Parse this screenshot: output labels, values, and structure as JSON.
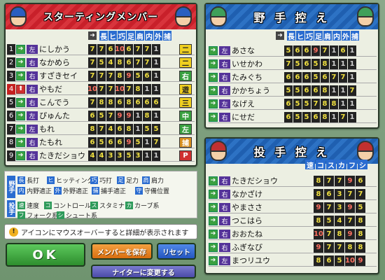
{
  "starting": {
    "title": "スターティングメンバー",
    "columns": [
      "長",
      "ヒ",
      "巧",
      "足",
      "肩",
      "内",
      "外",
      "捕"
    ],
    "players": [
      {
        "num": "1",
        "name": "にしかう",
        "hand": "左",
        "stats": [
          "7",
          "7",
          "6",
          "10",
          "6",
          "7",
          "7",
          "1"
        ],
        "pos": "二"
      },
      {
        "num": "2",
        "name": "なかめら",
        "hand": "右",
        "stats": [
          "7",
          "5",
          "4",
          "8",
          "6",
          "7",
          "7",
          "1"
        ],
        "pos": "二"
      },
      {
        "num": "3",
        "name": "すざきセイ",
        "hand": "右",
        "stats": [
          "7",
          "7",
          "7",
          "8",
          "9",
          "5",
          "6",
          "1"
        ],
        "pos": "右"
      },
      {
        "num": "4",
        "name": "やもだ",
        "hand": "右",
        "stats": [
          "10",
          "7",
          "7",
          "10",
          "7",
          "8",
          "1",
          "1"
        ],
        "pos": "遊"
      },
      {
        "num": "5",
        "name": "こんでう",
        "hand": "右",
        "stats": [
          "7",
          "8",
          "8",
          "6",
          "8",
          "6",
          "6",
          "6"
        ],
        "pos": "三"
      },
      {
        "num": "6",
        "name": "ぴゅんた",
        "hand": "左",
        "stats": [
          "6",
          "5",
          "7",
          "9",
          "9",
          "1",
          "8",
          "1"
        ],
        "pos": "中"
      },
      {
        "num": "7",
        "name": "もれ",
        "hand": "左",
        "stats": [
          "8",
          "7",
          "4",
          "6",
          "8",
          "1",
          "5",
          "5"
        ],
        "pos": "左"
      },
      {
        "num": "8",
        "name": "たもれ",
        "hand": "右",
        "stats": [
          "6",
          "5",
          "6",
          "6",
          "9",
          "5",
          "1",
          "7"
        ],
        "pos": "捕"
      },
      {
        "num": "9",
        "name": "たきだショウ",
        "hand": "右",
        "stats": [
          "4",
          "4",
          "3",
          "3",
          "5",
          "3",
          "1",
          "1"
        ],
        "pos": "P"
      }
    ]
  },
  "bench": {
    "title": "野 手 控 え",
    "columns": [
      "長",
      "ヒ",
      "巧",
      "足",
      "肩",
      "内",
      "外",
      "捕"
    ],
    "players": [
      {
        "name": "あさな",
        "hand": "左",
        "stats": [
          "5",
          "6",
          "6",
          "9",
          "7",
          "1",
          "6",
          "1"
        ]
      },
      {
        "name": "いせかわ",
        "hand": "右",
        "stats": [
          "7",
          "5",
          "6",
          "5",
          "8",
          "1",
          "1",
          "1"
        ]
      },
      {
        "name": "たみぐち",
        "hand": "右",
        "stats": [
          "6",
          "6",
          "6",
          "5",
          "6",
          "7",
          "7",
          "1"
        ]
      },
      {
        "name": "かかちょう",
        "hand": "右",
        "stats": [
          "5",
          "5",
          "6",
          "6",
          "8",
          "1",
          "1",
          "7"
        ]
      },
      {
        "name": "なげえ",
        "hand": "左",
        "stats": [
          "6",
          "5",
          "5",
          "7",
          "8",
          "8",
          "1",
          "1"
        ]
      },
      {
        "name": "にせだ",
        "hand": "右",
        "stats": [
          "6",
          "5",
          "5",
          "6",
          "8",
          "1",
          "7",
          "1"
        ]
      }
    ]
  },
  "pitchers": {
    "title": "投 手 控 え",
    "columns": [
      "速",
      "コ",
      "ス",
      "カ",
      "フ",
      "シ"
    ],
    "players": [
      {
        "name": "たきだショウ",
        "hand": "右",
        "stats": [
          "8",
          "7",
          "7",
          "9",
          "6"
        ]
      },
      {
        "name": "なかざけ",
        "hand": "右",
        "stats": [
          "8",
          "6",
          "3",
          "7",
          "7"
        ]
      },
      {
        "name": "やまささ",
        "hand": "右",
        "stats": [
          "9",
          "7",
          "3",
          "9",
          "5"
        ]
      },
      {
        "name": "つこはら",
        "hand": "右",
        "stats": [
          "8",
          "5",
          "4",
          "7",
          "8"
        ]
      },
      {
        "name": "おおたね",
        "hand": "右",
        "stats": [
          "10",
          "7",
          "8",
          "9",
          "8"
        ]
      },
      {
        "name": "ふぎなび",
        "hand": "右",
        "stats": [
          "9",
          "7",
          "7",
          "8",
          "8"
        ]
      },
      {
        "name": "まつリユウ",
        "hand": "左",
        "stats": [
          "8",
          "6",
          "5",
          "10",
          "9"
        ]
      }
    ]
  },
  "legend": {
    "fielder_tag": "野手",
    "pitcher_tag": "投手",
    "items": [
      {
        "k": "長",
        "t": "長打"
      },
      {
        "k": "ヒ",
        "t": "ヒッティング"
      },
      {
        "k": "巧",
        "t": "巧打"
      },
      {
        "k": "足",
        "t": "足力"
      },
      {
        "k": "肩",
        "t": "肩力"
      },
      {
        "k": "内",
        "t": "内野適正"
      },
      {
        "k": "外",
        "t": "外野適正"
      },
      {
        "k": "捕",
        "t": "捕手適正"
      },
      {
        "k": "守",
        "t": "守備位置"
      },
      {
        "k": "速",
        "t": "速度"
      },
      {
        "k": "コ",
        "t": "コントロール"
      },
      {
        "k": "ス",
        "t": "スタミナ"
      },
      {
        "k": "カ",
        "t": "カーブ系"
      },
      {
        "k": "フ",
        "t": "フォーク系"
      },
      {
        "k": "シ",
        "t": "シュート系"
      }
    ]
  },
  "notice": "アイコンにマウスオーバーすると詳細が表示されます",
  "buttons": {
    "ok": "OK",
    "save": "メンバーを保存",
    "reset": "リセット",
    "night": "ナイターに変更する"
  },
  "colors": {
    "ok": "#3aa83a",
    "save": "#e8801c",
    "reset": "#2f6cd8",
    "night": "#5a5ab8"
  }
}
